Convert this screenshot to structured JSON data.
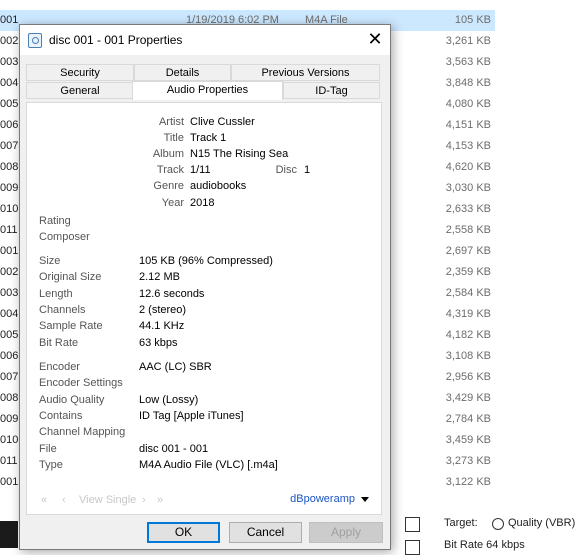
{
  "background": {
    "rows": [
      {
        "num": "001",
        "date": "1/19/2019 6:02 PM",
        "type": "M4A File",
        "size": "105 KB",
        "selected": true
      },
      {
        "num": "002",
        "size": "3,261 KB"
      },
      {
        "num": "003",
        "size": "3,563 KB"
      },
      {
        "num": "004",
        "size": "3,848 KB"
      },
      {
        "num": "005",
        "size": "4,080 KB"
      },
      {
        "num": "006",
        "size": "4,151 KB"
      },
      {
        "num": "007",
        "size": "4,153 KB"
      },
      {
        "num": "008",
        "size": "4,620 KB"
      },
      {
        "num": "009",
        "size": "3,030 KB"
      },
      {
        "num": "010",
        "size": "2,633 KB"
      },
      {
        "num": "011",
        "size": "2,558 KB"
      },
      {
        "num": "001",
        "size": "2,697 KB"
      },
      {
        "num": "002",
        "size": "2,359 KB"
      },
      {
        "num": "003",
        "size": "2,584 KB"
      },
      {
        "num": "004",
        "size": "4,319 KB"
      },
      {
        "num": "005",
        "size": "4,182 KB"
      },
      {
        "num": "006",
        "size": "3,108 KB"
      },
      {
        "num": "007",
        "size": "2,956 KB"
      },
      {
        "num": "008",
        "size": "3,429 KB"
      },
      {
        "num": "009",
        "size": "2,784 KB"
      },
      {
        "num": "010",
        "size": "3,459 KB"
      },
      {
        "num": "011",
        "size": "3,273 KB"
      },
      {
        "num": "001",
        "size": "3,122 KB"
      }
    ],
    "target_label": "Target:",
    "quality_label": "Quality (VBR)",
    "bitrate_label": "Bit Rate 64 kbps"
  },
  "dialog": {
    "title": "disc 001 - 001 Properties",
    "close_glyph": "✕",
    "tabs_row1": [
      "Security",
      "Details",
      "Previous Versions"
    ],
    "tabs_row2": [
      "General",
      "Audio Properties",
      "ID-Tag"
    ],
    "active_tab": "Audio Properties",
    "tag": {
      "artist_label": "Artist",
      "artist": "Clive Cussler",
      "title_label": "Title",
      "title": "Track 1",
      "album_label": "Album",
      "album": "N15 The Rising Sea",
      "track_label": "Track",
      "track": "1/11",
      "disc_label": "Disc",
      "disc": "1",
      "genre_label": "Genre",
      "genre": "audiobooks",
      "year_label": "Year",
      "year": "2018"
    },
    "rating_label": "Rating",
    "composer_label": "Composer",
    "props": [
      {
        "label": "Size",
        "value": "105 KB  (96% Compressed)"
      },
      {
        "label": "Original Size",
        "value": "2.12 MB"
      },
      {
        "label": "Length",
        "value": "12.6 seconds"
      },
      {
        "label": "Channels",
        "value": "2  (stereo)"
      },
      {
        "label": "Sample Rate",
        "value": "44.1 KHz"
      },
      {
        "label": "Bit Rate",
        "value": "63 kbps"
      }
    ],
    "encoder": [
      {
        "label": "Encoder",
        "value": "AAC (LC) SBR"
      },
      {
        "label": "Encoder Settings",
        "value": ""
      },
      {
        "label": "Audio Quality",
        "value": "Low  (Lossy)"
      },
      {
        "label": "Contains",
        "value": "ID Tag [Apple iTunes]"
      },
      {
        "label": "Channel Mapping",
        "value": ""
      },
      {
        "label": "File",
        "value": "disc 001 - 001"
      },
      {
        "label": "Type",
        "value": "M4A Audio File (VLC)    [.m4a]"
      }
    ],
    "nav_first": "«",
    "nav_prev": "‹",
    "nav_view": "View Single",
    "nav_next": "›",
    "nav_last": "»",
    "dbpoweramp_label": "dBpoweramp",
    "buttons": {
      "ok": "OK",
      "cancel": "Cancel",
      "apply": "Apply"
    }
  }
}
